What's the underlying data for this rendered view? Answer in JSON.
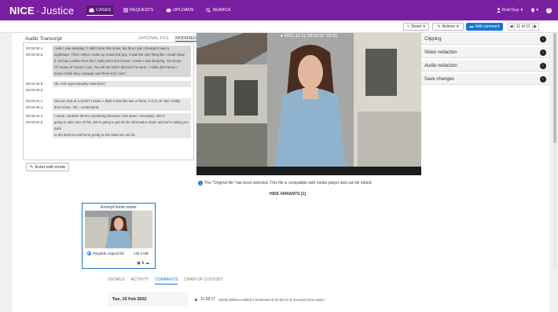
{
  "app": {
    "logo_brand": "NICE",
    "logo_sep": "·",
    "logo_product": "Justice"
  },
  "nav": {
    "items": [
      {
        "label": "CASES",
        "icon": "briefcase-icon",
        "active": true
      },
      {
        "label": "REQUESTS",
        "icon": "list-icon",
        "active": false
      },
      {
        "label": "UPLOADS",
        "icon": "cloud-upload-icon",
        "active": false
      },
      {
        "label": "SEARCH",
        "icon": "search-icon",
        "active": false
      }
    ],
    "user": "Rod Guy",
    "bell": "bell-icon",
    "help": "help-icon"
  },
  "toolbar": {
    "share": "Share",
    "actions": "Actions",
    "add_comment": "Add comment",
    "pager": "11 of 12"
  },
  "transcript": {
    "title": "Audio Transcript",
    "tab_original": "ORIGINAL FILE",
    "tab_modified": "MODIFIED",
    "segments": [
      {
        "t1": "00:00:00.1",
        "t2": "00:00:26.6",
        "lines": [
          "I was I was sleeping I I didn't hear that noise, but then I just I thought it was a",
          "nightmare. Then I when I woke up it was this guy. It was the only thing like I could show",
          "it. He has a tattoo here but I really don't don't know. I mean I was sleeping. You know",
          "Of course of course I can. You tell me which direction he went. I really don't know. I",
          "mean I think they runaway over there but I can't."
        ]
      },
      {
        "t1": "00:00:26.9",
        "t2": "00:00:29.5",
        "lines": [
          "Ok. And Approximately what time?"
        ]
      },
      {
        "t1": "00:00:31.1",
        "t2": "00:00:36.4",
        "lines": [
          "Did you look at a clock? I mean, I think it was like two or three, 2 or 3, ok. But I really",
          "don't know.. OK, I understand."
        ]
      },
      {
        "t1": "00:00:42.2",
        "t2": "00:00:52.8",
        "lines": [
          "I mean, I believe there's something because I live alone. Absolutely. We're",
          "going to take care of this. We're going to get all the information down and we're taking you back",
          "to the precinct and we're going to see what we can do."
        ]
      }
    ],
    "edit_button": "Enter edit mode"
  },
  "video": {
    "timestamp": "2021-12-11 08:53:23 -05:00"
  },
  "right_panel": {
    "rows": [
      "Clipping",
      "Video redaction",
      "Audio redaction",
      "Save changes"
    ]
  },
  "info": {
    "message": "The \"Original file\" has been selected. This file is compatible with media player and can be edited.",
    "hide_variants": "HIDE VARIANTS [1]"
  },
  "excerpt": {
    "title": "Excerpt home owner",
    "label": "Playable original file",
    "size": "135.4 MB"
  },
  "tabs": [
    "DETAILS",
    "ACTIVITY",
    "COMMENTS",
    "CHAIN OF CUSTODY"
  ],
  "active_tab": "COMMENTS",
  "activity": {
    "date": "Tue, 15 Feb 2022",
    "time": "11:58:17",
    "text": "Shelly Williams added a bookmark at 00:00:13 on Excerpt home owner"
  },
  "colors": {
    "brand": "#7b1fa2",
    "accent": "#1976d2"
  }
}
